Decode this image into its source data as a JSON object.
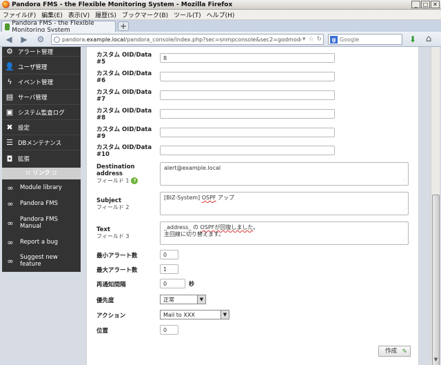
{
  "window": {
    "title": "Pandora FMS - the Flexible Monitoring System - Mozilla Firefox"
  },
  "menu": [
    "ファイル(F)",
    "編集(E)",
    "表示(V)",
    "履歴(S)",
    "ブックマーク(B)",
    "ツール(T)",
    "ヘルプ(H)"
  ],
  "tab": {
    "label": "Pandora FMS - the Flexible Monitoring System",
    "new_tab": "+"
  },
  "nav": {
    "url_prefix": "pandora.",
    "url_host": "example.local",
    "url_rest": "/pandora_console/index.php?sec=snmpconsole&sec2=godmode/snmpconsole/snm",
    "search_placeholder": "Google",
    "search_engine": "g"
  },
  "sidebar": {
    "items": [
      {
        "label": "アラート管理",
        "icon": "bell-icon"
      },
      {
        "label": "ユーザ管理",
        "icon": "users-icon"
      },
      {
        "label": "イベント管理",
        "icon": "event-icon"
      },
      {
        "label": "サーバ管理",
        "icon": "server-icon"
      },
      {
        "label": "システム監査ログ",
        "icon": "log-icon"
      },
      {
        "label": "設定",
        "icon": "tools-icon"
      },
      {
        "label": "DBメンテナンス",
        "icon": "db-icon"
      },
      {
        "label": "拡張",
        "icon": "plugin-icon"
      }
    ],
    "section": ":: リンク ::",
    "links": [
      "Module library",
      "Pandora FMS",
      "Pandora FMS Manual",
      "Report a bug",
      "Suggest new feature"
    ]
  },
  "form": {
    "custom_fields": [
      {
        "label": "カスタム OID/Data #5",
        "value": "8"
      },
      {
        "label": "カスタム OID/Data #6",
        "value": ""
      },
      {
        "label": "カスタム OID/Data #7",
        "value": ""
      },
      {
        "label": "カスタム OID/Data #8",
        "value": ""
      },
      {
        "label": "カスタム OID/Data #9",
        "value": ""
      },
      {
        "label": "カスタム OID/Data #10",
        "value": ""
      }
    ],
    "destination": {
      "label": "Destination address",
      "sub": "フィールド 1",
      "value": "alert@example.local"
    },
    "subject": {
      "label": "Subject",
      "sub": "フィールド 2",
      "value_a": "[BIZ-System] ",
      "value_b": "OSPF",
      "value_c": " アップ"
    },
    "text": {
      "label": "Text",
      "sub": "フィールド 3",
      "line1_a": "_address_ の ",
      "line1_b": "OSPFが回復しました",
      "line1_c": "。",
      "line2": "主回線に切り替えます。"
    },
    "min_alerts": {
      "label": "最小アラート数",
      "value": "0"
    },
    "max_alerts": {
      "label": "最大アラート数",
      "value": "1"
    },
    "renotify": {
      "label": "再通知間隔",
      "value": "0",
      "unit": "秒"
    },
    "priority": {
      "label": "優先度",
      "value": "正常"
    },
    "action": {
      "label": "アクション",
      "value": "Mail to XXX"
    },
    "position": {
      "label": "位置",
      "value": "0"
    },
    "create_label": "作成"
  }
}
